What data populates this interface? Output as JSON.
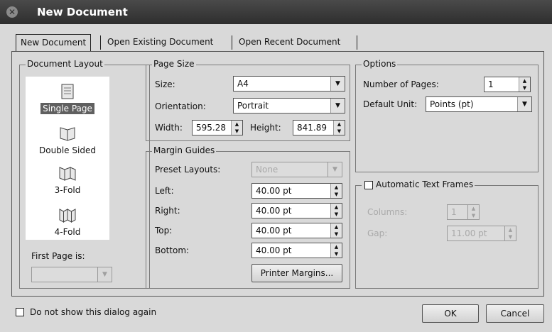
{
  "window": {
    "title": "New Document"
  },
  "tabs": [
    "New Document",
    "Open Existing Document",
    "Open Recent Document"
  ],
  "document_layout": {
    "legend": "Document Layout",
    "items": [
      {
        "label": "Single Page",
        "icon": "single-page-icon",
        "selected": true
      },
      {
        "label": "Double Sided",
        "icon": "double-sided-icon",
        "selected": false
      },
      {
        "label": "3-Fold",
        "icon": "three-fold-icon",
        "selected": false
      },
      {
        "label": "4-Fold",
        "icon": "four-fold-icon",
        "selected": false
      }
    ],
    "first_page_label": "First Page is:",
    "first_page_value": ""
  },
  "page_size": {
    "legend": "Page Size",
    "size_label": "Size:",
    "size_value": "A4",
    "orientation_label": "Orientation:",
    "orientation_value": "Portrait",
    "width_label": "Width:",
    "width_value": "595.28",
    "height_label": "Height:",
    "height_value": "841.89"
  },
  "margin_guides": {
    "legend": "Margin Guides",
    "preset_label": "Preset Layouts:",
    "preset_value": "None",
    "left_label": "Left:",
    "left_value": "40.00 pt",
    "right_label": "Right:",
    "right_value": "40.00 pt",
    "top_label": "Top:",
    "top_value": "40.00 pt",
    "bottom_label": "Bottom:",
    "bottom_value": "40.00 pt",
    "printer_margins_label": "Printer Margins..."
  },
  "options": {
    "legend": "Options",
    "pages_label": "Number of Pages:",
    "pages_value": "1",
    "unit_label": "Default Unit:",
    "unit_value": "Points (pt)"
  },
  "text_frames": {
    "legend": "Automatic Text Frames",
    "checked": false,
    "columns_label": "Columns:",
    "columns_value": "1",
    "gap_label": "Gap:",
    "gap_value": "11.00 pt"
  },
  "footer": {
    "dont_show_label": "Do not show this dialog again",
    "ok_label": "OK",
    "cancel_label": "Cancel"
  }
}
